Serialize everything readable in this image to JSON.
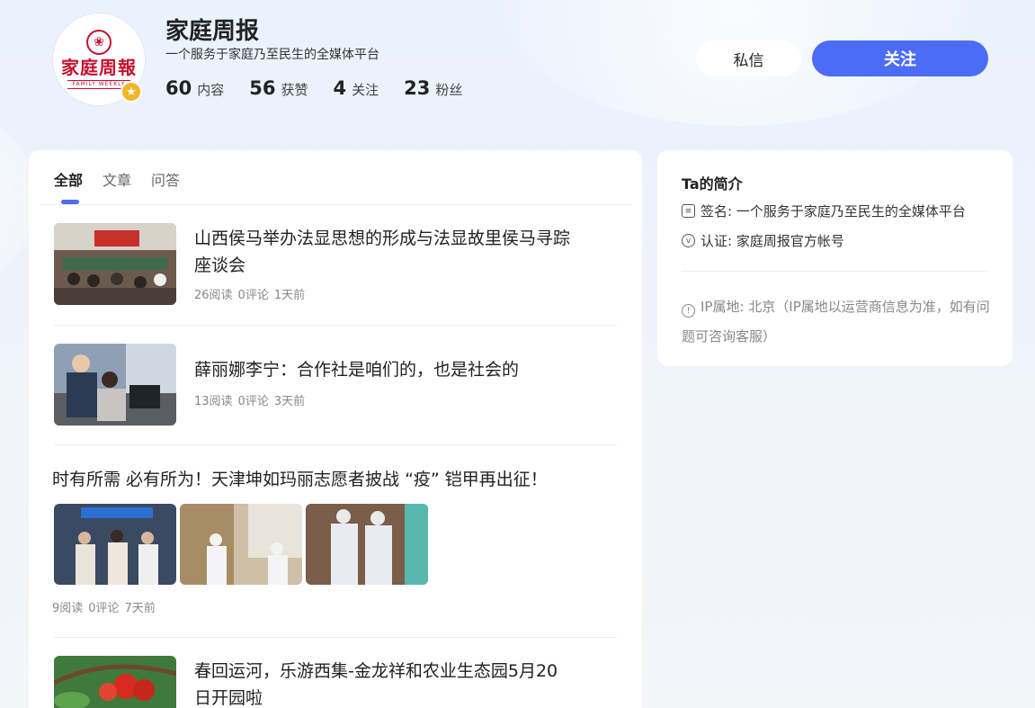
{
  "profile": {
    "name": "家庭周报",
    "description": "一个服务于家庭乃至民生的全媒体平台",
    "avatar_logo_text": "家庭周報",
    "avatar_logo_sub": "FAMILY WEEKLY",
    "stats": [
      {
        "num": "60",
        "label": "内容"
      },
      {
        "num": "56",
        "label": "获赞"
      },
      {
        "num": "4",
        "label": "关注"
      },
      {
        "num": "23",
        "label": "粉丝"
      }
    ]
  },
  "actions": {
    "message_label": "私信",
    "follow_label": "关注"
  },
  "tabs": [
    {
      "label": "全部",
      "active": true
    },
    {
      "label": "文章",
      "active": false
    },
    {
      "label": "问答",
      "active": false
    }
  ],
  "feed": [
    {
      "title": "山西侯马举办法显思想的形成与法显故里侯马寻踪座谈会",
      "reads": "26阅读",
      "comments": "0评论",
      "time": "1天前"
    },
    {
      "title": "薛丽娜李宁：合作社是咱们的，也是社会的",
      "reads": "13阅读",
      "comments": "0评论",
      "time": "3天前"
    },
    {
      "title": "时有所需 必有所为！天津坤如玛丽志愿者披战 “疫” 铠甲再出征！",
      "reads": "9阅读",
      "comments": "0评论",
      "time": "7天前"
    },
    {
      "title": "春回运河，乐游西集-金龙祥和农业生态园5月20日开园啦"
    }
  ],
  "intro": {
    "title": "Ta的简介",
    "signature": "签名: 一个服务于家庭乃至民生的全媒体平台",
    "certification": "认证: 家庭周报官方帐号",
    "ip": "IP属地: 北京（IP属地以运营商信息为准，如有问题可咨询客服）"
  },
  "colors": {
    "accent": "#4d6cf5",
    "brand_red": "#c8102e",
    "badge_gold": "#f2b529"
  }
}
